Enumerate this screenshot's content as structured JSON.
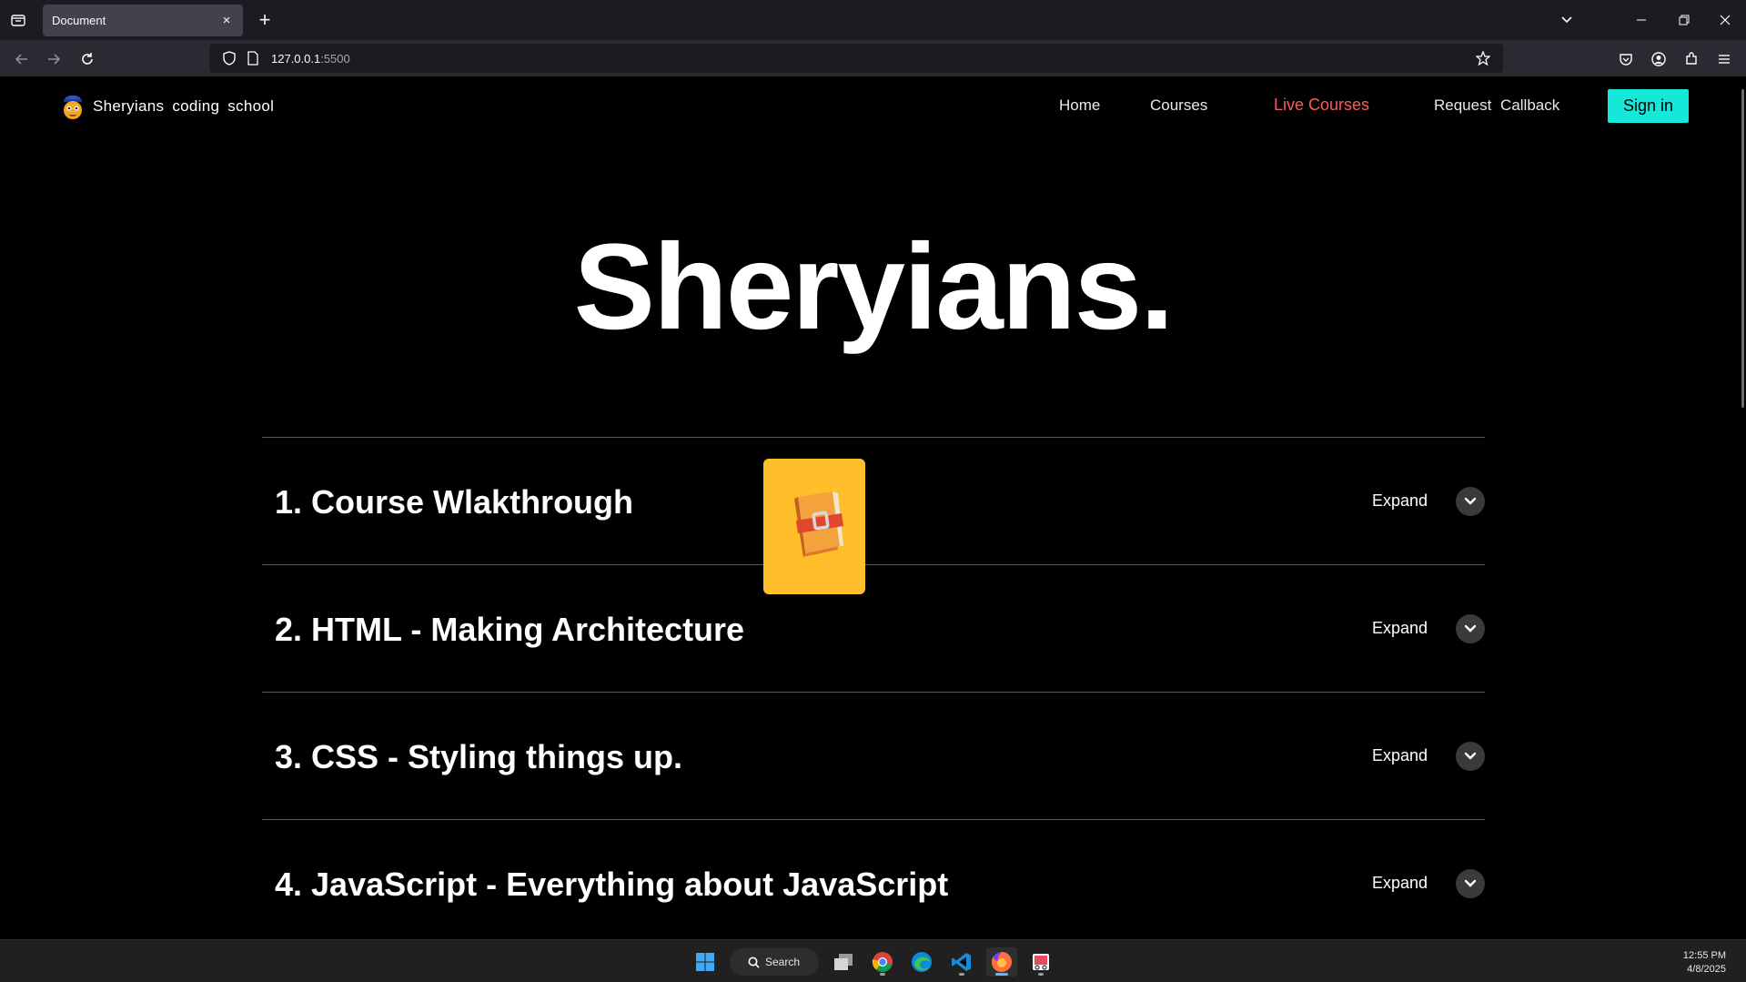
{
  "browser": {
    "tab_title": "Document",
    "tab_close": "×",
    "new_tab": "+",
    "url_host": "127.0.0.1",
    "url_port": ":5500"
  },
  "site": {
    "brand": "Sheryians coding school",
    "nav": {
      "home": "Home",
      "courses": "Courses",
      "live_courses": "Live Courses",
      "request_callback": "Request Callback",
      "sign_in": "Sign in"
    },
    "hero_title": "Sheryians.",
    "expand_label": "Expand",
    "courses": [
      {
        "title": "1. Course Wlakthrough"
      },
      {
        "title": "2. HTML - Making Architecture"
      },
      {
        "title": "3. CSS - Styling things up."
      },
      {
        "title": "4. JavaScript - Everything about JavaScript"
      }
    ],
    "colors": {
      "accent_signin": "#15e8d8",
      "live_courses": "#ff5a5a",
      "card": "#ffbf2a"
    }
  },
  "taskbar": {
    "search_label": "Search",
    "time": "12:55 PM",
    "date": "4/8/2025"
  }
}
